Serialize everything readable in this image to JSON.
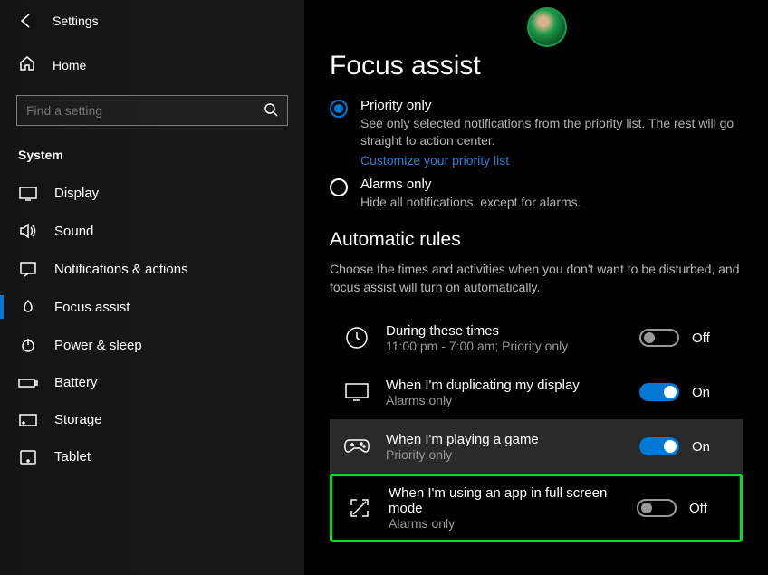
{
  "header": {
    "app_title": "Settings"
  },
  "sidebar": {
    "home_label": "Home",
    "search_placeholder": "Find a setting",
    "section_label": "System",
    "items": [
      {
        "label": "Display"
      },
      {
        "label": "Sound"
      },
      {
        "label": "Notifications & actions"
      },
      {
        "label": "Focus assist"
      },
      {
        "label": "Power & sleep"
      },
      {
        "label": "Battery"
      },
      {
        "label": "Storage"
      },
      {
        "label": "Tablet"
      }
    ]
  },
  "main": {
    "title": "Focus assist",
    "options": {
      "priority": {
        "label": "Priority only",
        "desc": "See only selected notifications from the priority list. The rest will go straight to action center.",
        "link": "Customize your priority list"
      },
      "alarms": {
        "label": "Alarms only",
        "desc": "Hide all notifications, except for alarms."
      }
    },
    "rules_heading": "Automatic rules",
    "rules_desc": "Choose the times and activities when you don't want to be disturbed, and focus assist will turn on automatically.",
    "rules": [
      {
        "title": "During these times",
        "sub": "11:00 pm - 7:00 am; Priority only",
        "state": "Off"
      },
      {
        "title": "When I'm duplicating my display",
        "sub": "Alarms only",
        "state": "On"
      },
      {
        "title": "When I'm playing a game",
        "sub": "Priority only",
        "state": "On"
      },
      {
        "title": "When I'm using an app in full screen mode",
        "sub": "Alarms only",
        "state": "Off"
      }
    ]
  }
}
